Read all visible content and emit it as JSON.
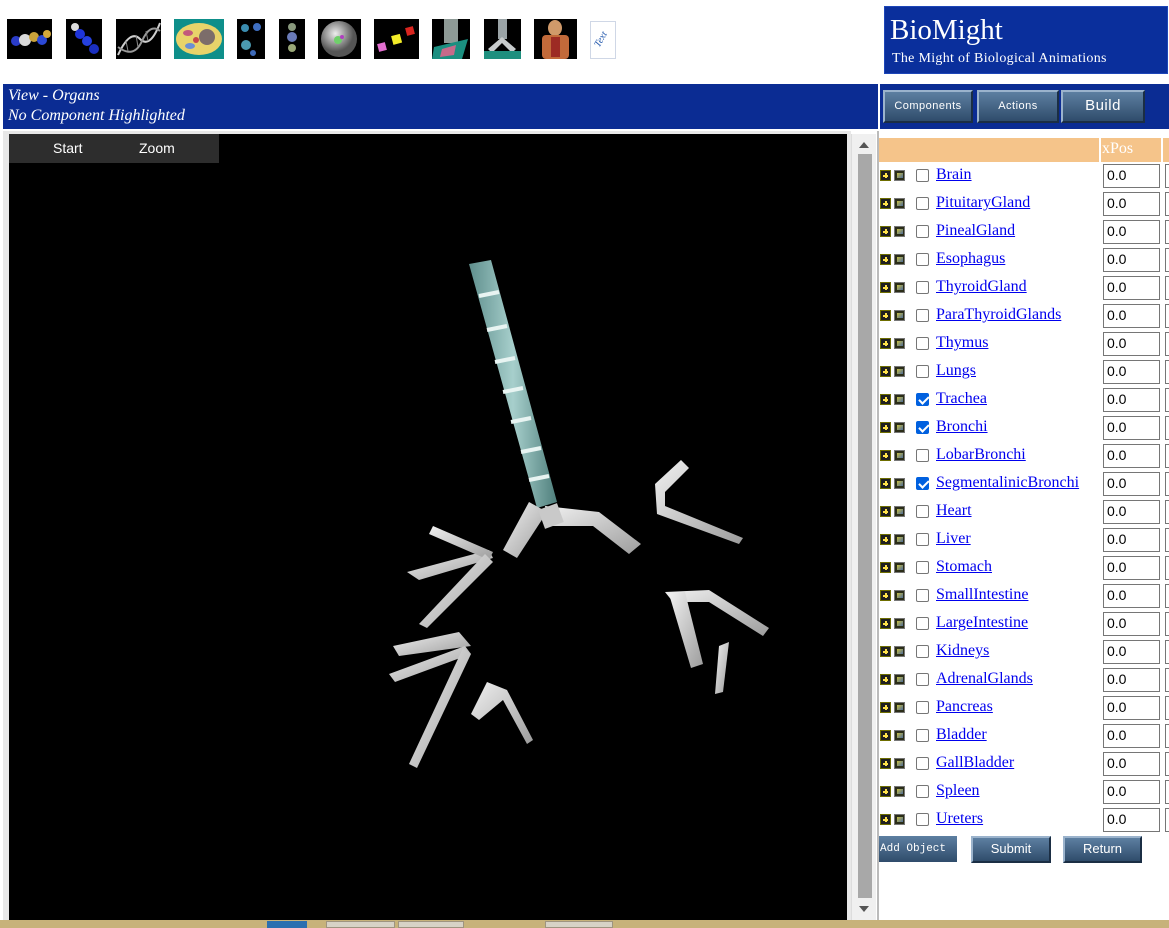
{
  "toolbar": {
    "icons": [
      "molecule-icon",
      "atom-chain-icon",
      "dna-helix-icon",
      "cell-icon",
      "cell-division-icon",
      "chromosome-icon",
      "sphere-cell-icon",
      "cubes-icon",
      "tissue-icon",
      "organ-icon",
      "human-body-icon",
      "text-icon"
    ],
    "text_icon_label": "Text"
  },
  "logo": {
    "title": "BioMight",
    "subtitle": "The Might of Biological Animations"
  },
  "view": {
    "line1": "View - Organs",
    "line2": "No Component Highlighted"
  },
  "nav_buttons": {
    "components": "Components",
    "actions": "Actions",
    "build": "Build"
  },
  "viewer": {
    "menu_start": "Start",
    "menu_zoom": "Zoom"
  },
  "table": {
    "col_xpos": "xPos",
    "rows": [
      {
        "name": "Brain",
        "checked": false,
        "x": "0.0"
      },
      {
        "name": "PituitaryGland",
        "checked": false,
        "x": "0.0"
      },
      {
        "name": "PinealGland",
        "checked": false,
        "x": "0.0"
      },
      {
        "name": "Esophagus",
        "checked": false,
        "x": "0.0"
      },
      {
        "name": "ThyroidGland",
        "checked": false,
        "x": "0.0"
      },
      {
        "name": "ParaThyroidGlands",
        "checked": false,
        "x": "0.0"
      },
      {
        "name": "Thymus",
        "checked": false,
        "x": "0.0"
      },
      {
        "name": "Lungs",
        "checked": false,
        "x": "0.0"
      },
      {
        "name": "Trachea",
        "checked": true,
        "x": "0.0"
      },
      {
        "name": "Bronchi",
        "checked": true,
        "x": "0.0"
      },
      {
        "name": "LobarBronchi",
        "checked": false,
        "x": "0.0"
      },
      {
        "name": "SegmentalinicBronchi",
        "checked": true,
        "x": "0.0"
      },
      {
        "name": "Heart",
        "checked": false,
        "x": "0.0"
      },
      {
        "name": "Liver",
        "checked": false,
        "x": "0.0"
      },
      {
        "name": "Stomach",
        "checked": false,
        "x": "0.0"
      },
      {
        "name": "SmallIntestine",
        "checked": false,
        "x": "0.0"
      },
      {
        "name": "LargeIntestine",
        "checked": false,
        "x": "0.0"
      },
      {
        "name": "Kidneys",
        "checked": false,
        "x": "0.0"
      },
      {
        "name": "AdrenalGlands",
        "checked": false,
        "x": "0.0"
      },
      {
        "name": "Pancreas",
        "checked": false,
        "x": "0.0"
      },
      {
        "name": "Bladder",
        "checked": false,
        "x": "0.0"
      },
      {
        "name": "GallBladder",
        "checked": false,
        "x": "0.0"
      },
      {
        "name": "Spleen",
        "checked": false,
        "x": "0.0"
      },
      {
        "name": "Ureters",
        "checked": false,
        "x": "0.0"
      }
    ]
  },
  "actions": {
    "add_object": "Add Object",
    "submit": "Submit",
    "return": "Return"
  },
  "colors": {
    "header_blue": "#0b2c93",
    "table_header": "#f5c48a",
    "link": "#0000ee",
    "checkbox_on": "#0060df"
  }
}
